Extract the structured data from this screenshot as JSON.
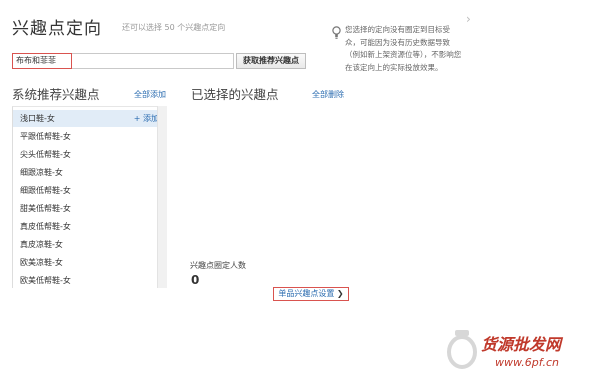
{
  "page": {
    "title": "兴趣点定向",
    "subtitle": "还可以选择 50 个兴趣点定向"
  },
  "search": {
    "value": "布布和菲菲",
    "button_label": "获取推荐兴趣点"
  },
  "notice": {
    "text": "您选择的定向没有圈定到目标受众，可能因为没有历史数据导致（例如新上架资源位等），不影响您在该定向上的实际投放效果。"
  },
  "recommended": {
    "title": "系统推荐兴趣点",
    "add_all_label": "全部添加",
    "add_label": "+ 添加",
    "items": [
      "浅口鞋-女",
      "平跟低帮鞋-女",
      "尖头低帮鞋-女",
      "细跟凉鞋-女",
      "细跟低帮鞋-女",
      "甜美低帮鞋-女",
      "真皮低帮鞋-女",
      "真皮凉鞋-女",
      "欧美凉鞋-女",
      "欧美低帮鞋-女"
    ]
  },
  "selected": {
    "title": "已选择的兴趣点",
    "delete_all_label": "全部删除",
    "fixed_count_label": "兴趣点圈定人数",
    "fixed_count_value": "0",
    "settings_button_label": "单品兴趣点设置",
    "settings_chevron": "❯"
  },
  "watermark": {
    "text": "货源批发网",
    "url": "www.6pf.cn"
  },
  "colors": {
    "link": "#2b6cb0",
    "highlight_border": "#d9534f",
    "selected_row": "#e1ecf7",
    "watermark": "#c0392b"
  }
}
